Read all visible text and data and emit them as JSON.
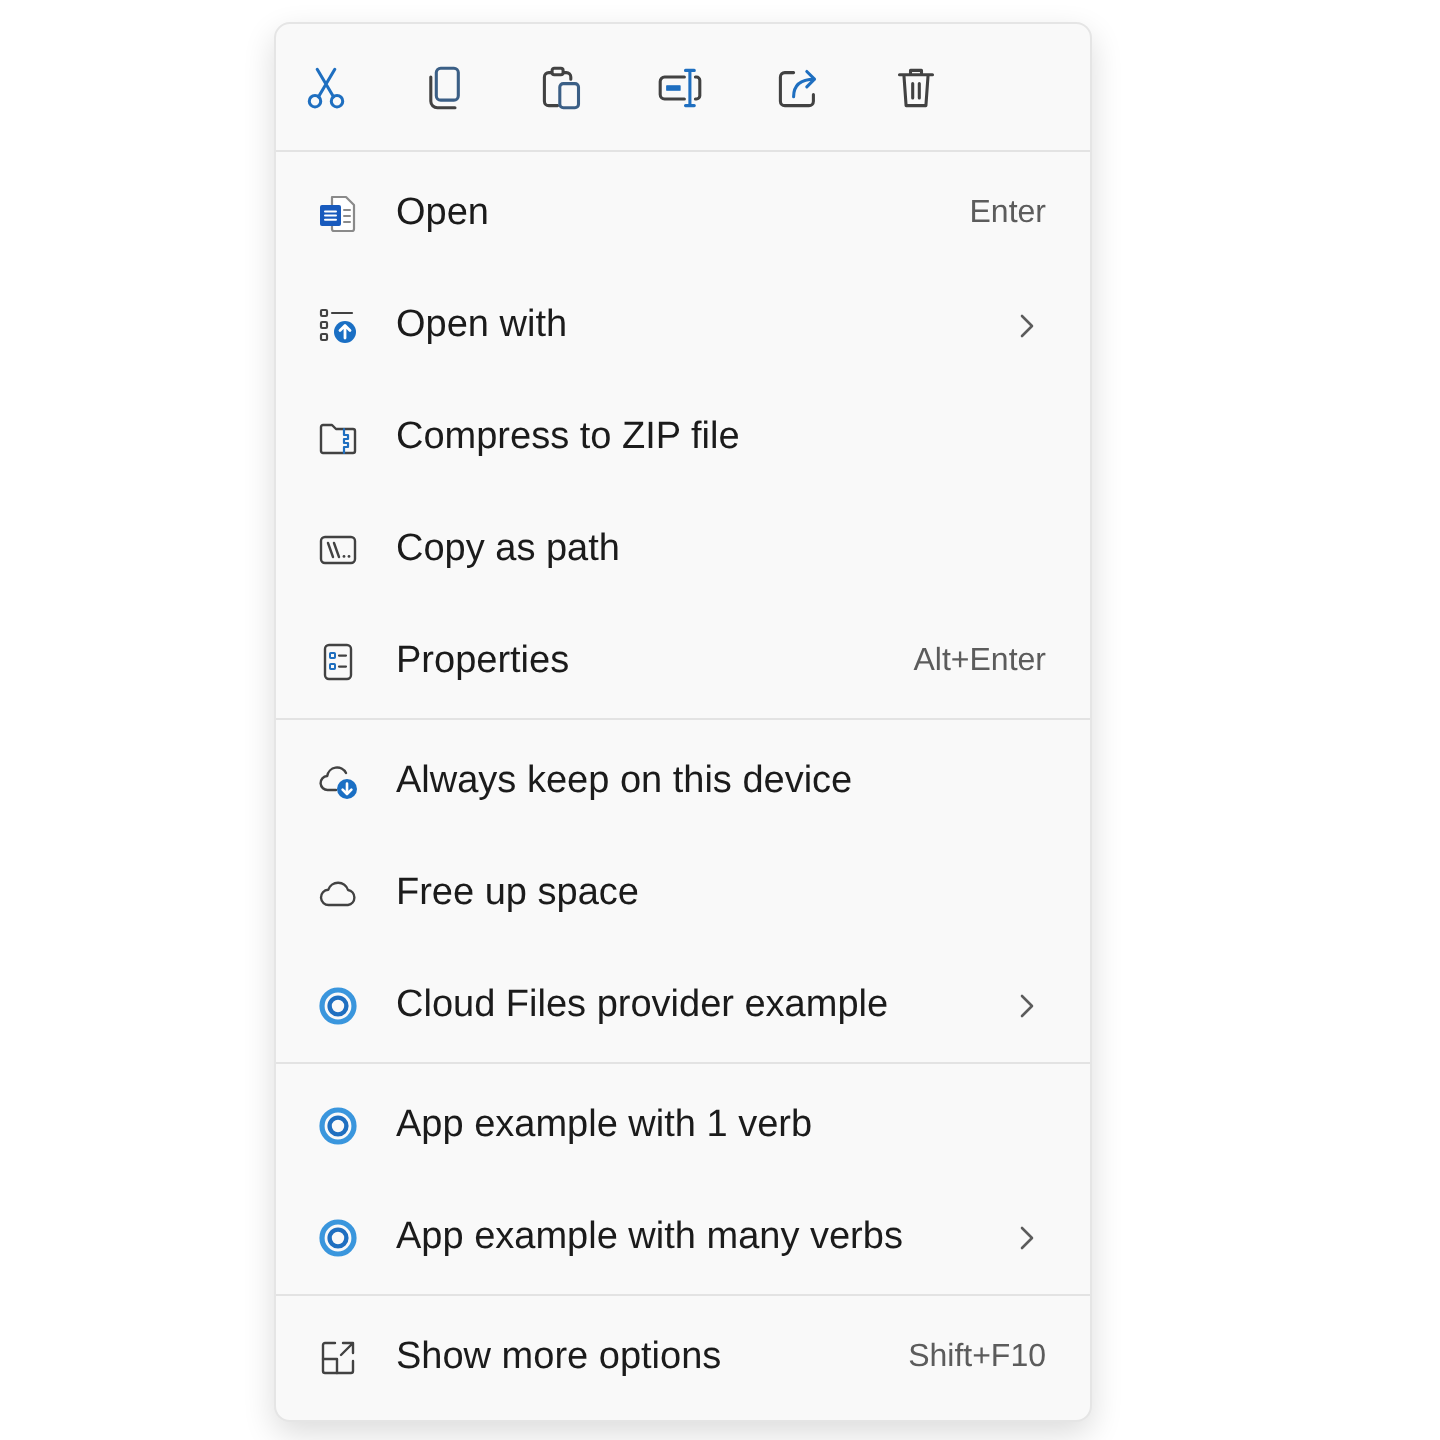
{
  "sections": [
    {
      "items": [
        {
          "label": "Open",
          "shortcut": "Enter",
          "submenu": false
        },
        {
          "label": "Open with",
          "submenu": true
        },
        {
          "label": "Compress to ZIP file",
          "submenu": false
        },
        {
          "label": "Copy as path",
          "submenu": false
        },
        {
          "label": "Properties",
          "shortcut": "Alt+Enter",
          "submenu": false
        }
      ]
    },
    {
      "items": [
        {
          "label": "Always keep on this device",
          "submenu": false
        },
        {
          "label": "Free up space",
          "submenu": false
        },
        {
          "label": "Cloud Files provider example",
          "submenu": true
        }
      ]
    },
    {
      "items": [
        {
          "label": "App example with 1 verb",
          "submenu": false
        },
        {
          "label": "App example with many verbs",
          "submenu": true
        }
      ]
    },
    {
      "items": [
        {
          "label": "Show more options",
          "shortcut": "Shift+F10",
          "submenu": false
        }
      ]
    }
  ]
}
